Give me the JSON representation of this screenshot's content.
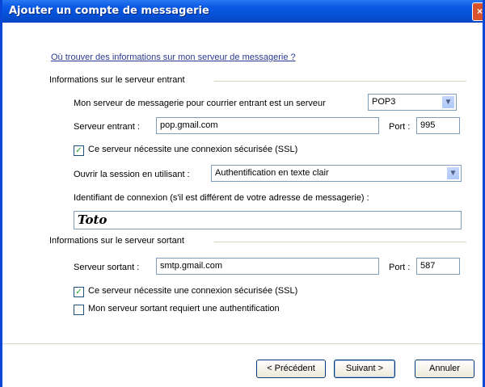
{
  "window": {
    "title": "Ajouter un compte de messagerie",
    "close_glyph": "×"
  },
  "help_link": "Où trouver des informations sur mon serveur de messagerie ?",
  "incoming": {
    "group_label": "Informations sur le serveur entrant",
    "server_type_label": "Mon serveur de messagerie pour courrier entrant est un serveur",
    "server_type_value": "POP3",
    "server_label": "Serveur entrant :",
    "server_value": "pop.gmail.com",
    "port_label": "Port :",
    "port_value": "995",
    "ssl_label": "Ce serveur nécessite une connexion sécurisée (SSL)",
    "ssl_checked": true,
    "logon_label": "Ouvrir la session en utilisant :",
    "logon_value": "Authentification en texte clair",
    "login_id_label": "Identifiant de connexion (s'il est différent de votre adresse de messagerie) :",
    "login_id_value": "Toto"
  },
  "outgoing": {
    "group_label": "Informations sur le serveur sortant",
    "server_label": "Serveur sortant :",
    "server_value": "smtp.gmail.com",
    "port_label": "Port :",
    "port_value": "587",
    "ssl_label": "Ce serveur nécessite une connexion sécurisée (SSL)",
    "ssl_checked": true,
    "auth_label": "Mon serveur sortant requiert une authentification",
    "auth_checked": false
  },
  "buttons": {
    "previous": "< Précédent",
    "next": "Suivant >",
    "cancel": "Annuler"
  },
  "colors": {
    "title_bar": "#0a5ae6",
    "close_button": "#d8522d",
    "link": "#2a3a8e"
  },
  "icons": {
    "dropdown": "chevron-down-icon",
    "checkmark": "checkmark-icon"
  }
}
